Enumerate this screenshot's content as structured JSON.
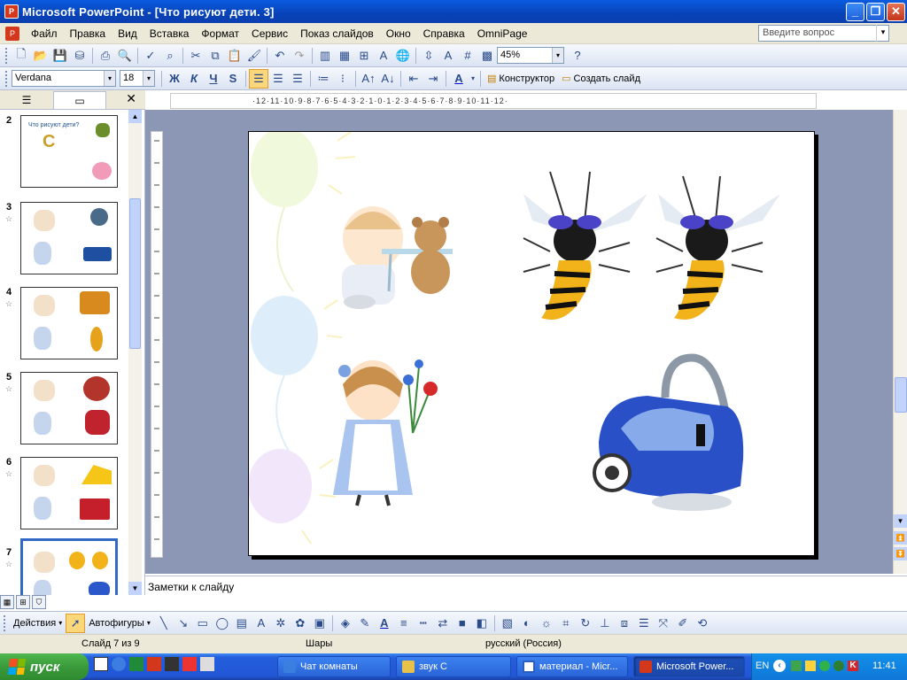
{
  "window": {
    "title": "Microsoft PowerPoint - [Что рисуют дети. 3]",
    "buttons": [
      "minimize",
      "restore",
      "close"
    ]
  },
  "menubar": {
    "items": [
      "Файл",
      "Правка",
      "Вид",
      "Вставка",
      "Формат",
      "Сервис",
      "Показ слайдов",
      "Окно",
      "Справка",
      "OmniPage"
    ],
    "ask_placeholder": "Введите вопрос"
  },
  "toolbar_standard": {
    "zoom": "45%"
  },
  "toolbar_format": {
    "font": "Verdana",
    "size": "18",
    "bold": "Ж",
    "italic": "К",
    "underline": "Ч",
    "shadow": "S",
    "design_label": "Конструктор",
    "new_slide_label": "Создать слайд"
  },
  "left_panel": {
    "thumbnails": [
      {
        "num": "2",
        "title": "Что рисуют дети?",
        "letter": "С"
      },
      {
        "num": "3"
      },
      {
        "num": "4"
      },
      {
        "num": "5"
      },
      {
        "num": "6"
      },
      {
        "num": "7",
        "active": true
      }
    ]
  },
  "ruler": {
    "text": "·12·11·10·9·8·7·6·5·4·3·2·1·0·1·2·3·4·5·6·7·8·9·10·11·12·"
  },
  "notes": {
    "placeholder": "Заметки к слайду"
  },
  "drawing_toolbar": {
    "actions_label": "Действия",
    "autoshapes_label": "Автофигуры"
  },
  "statusbar": {
    "slide_info": "Слайд 7 из 9",
    "design": "Шары",
    "language": "русский (Россия)"
  },
  "taskbar": {
    "start_label": "пуск",
    "tasks": [
      {
        "label": "Чат комнаты",
        "color": "#3a7fe0"
      },
      {
        "label": "звук С",
        "color": "#e8c14a"
      },
      {
        "label": "материал - Micr...",
        "color": "#2b5fbf"
      },
      {
        "label": "Microsoft Power...",
        "color": "#d4381c",
        "active": true
      }
    ],
    "lang": "EN",
    "clock": "11:41"
  }
}
